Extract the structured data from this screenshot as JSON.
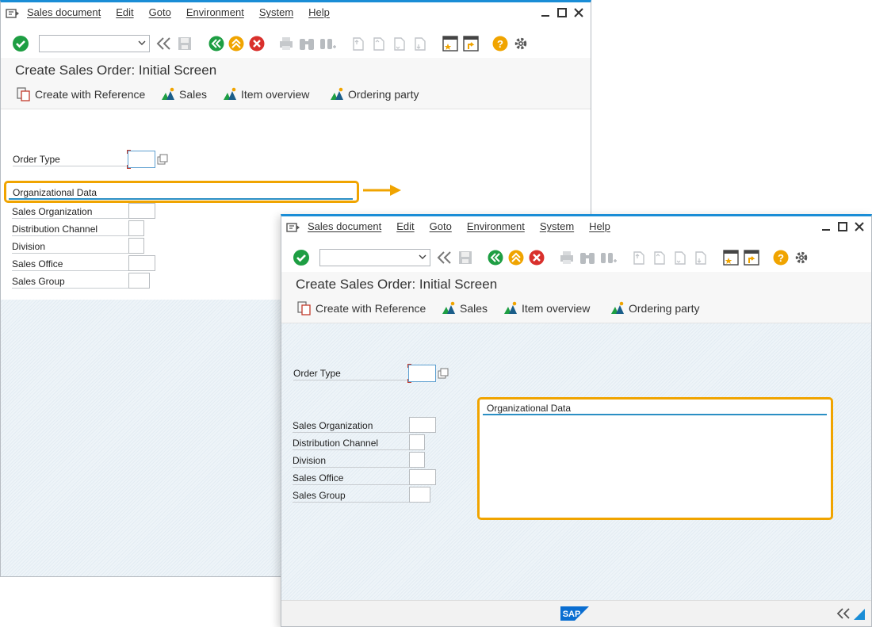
{
  "menu": [
    "Sales document",
    "Edit",
    "Goto",
    "Environment",
    "System",
    "Help"
  ],
  "screen_title": "Create Sales Order: Initial Screen",
  "app_toolbar": {
    "create_with_reference": "Create with Reference",
    "sales": "Sales",
    "item_overview": "Item overview",
    "ordering_party": "Ordering party"
  },
  "command_field": {
    "value": ""
  },
  "fields": {
    "order_type": "Order Type",
    "org_data_title": "Organizational Data",
    "sales_organization": "Sales Organization",
    "distribution_channel": "Distribution Channel",
    "division": "Division",
    "sales_office": "Sales Office",
    "sales_group": "Sales Group"
  },
  "colors": {
    "accent_blue": "#1a8dd6",
    "highlight": "#f0a400",
    "enter_green": "#1e9e43",
    "cancel_red": "#d9302c",
    "help_yellow": "#f0a400"
  },
  "logo": "SAP"
}
